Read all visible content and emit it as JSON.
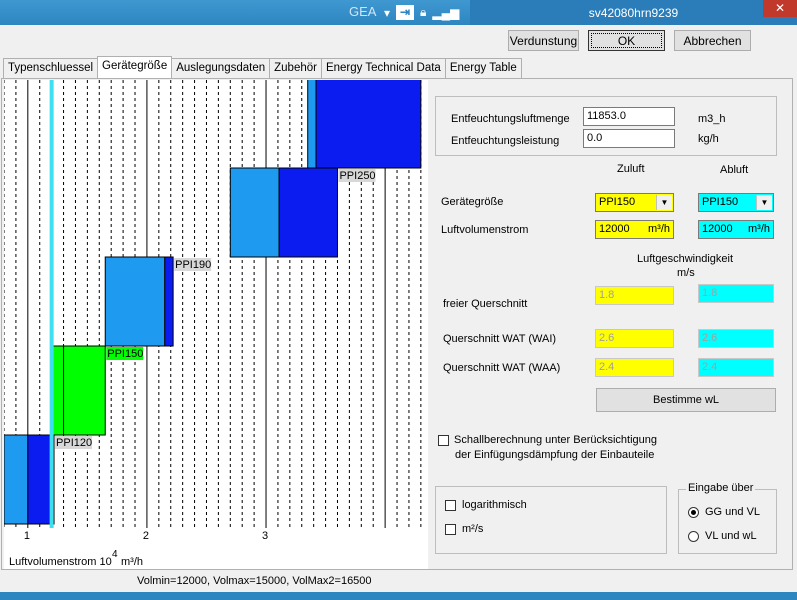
{
  "window": {
    "app_title": "GEA",
    "host_title": "sv42080hrn9239",
    "close_glyph": "✕"
  },
  "toolbar": {
    "verdunstung_label": "Verdunstung",
    "ok_label": "OK",
    "abbrechen_label": "Abbrechen"
  },
  "tabs": [
    {
      "label": "Typenschluessel"
    },
    {
      "label": "Gerätegröße"
    },
    {
      "label": "Auslegungsdaten"
    },
    {
      "label": "Zubehör"
    },
    {
      "label": "Energy Technical Data"
    },
    {
      "label": "Energy Table"
    }
  ],
  "form": {
    "entfeuchtungsluftmenge_label": "Entfeuchtungsluftmenge",
    "entfeuchtungsluftmenge_value": "11853.0",
    "entfeuchtungsluftmenge_unit": "m3_h",
    "entfeuchtungsleistung_label": "Entfeuchtungsleistung",
    "entfeuchtungsleistung_value": "0.0",
    "entfeuchtungsleistung_unit": "kg/h",
    "zuluft_header": "Zuluft",
    "abluft_header": "Abluft",
    "geraetegroesse_label": "Gerätegröße",
    "geraetegroesse_zuluft": "PPI150",
    "geraetegroesse_abluft": "PPI150",
    "luftvolumenstrom_label": "Luftvolumenstrom",
    "luftvolumenstrom_zuluft": "12000",
    "luftvolumenstrom_abluft": "12000",
    "luftvolumenstrom_unit": "m³/h",
    "luftgeschwindigkeit_header": "Luftgeschwindigkeit",
    "luftgeschwindigkeit_unit": "m/s",
    "freier_querschnitt_label": "freier Querschnitt",
    "freier_querschnitt_zuluft": "1.8",
    "freier_querschnitt_abluft": "1.8",
    "querschnitt_wai_label": "Querschnitt WAT (WAI)",
    "querschnitt_wai_zuluft": "2.6",
    "querschnitt_wai_abluft": "2.6",
    "querschnitt_waa_label": "Querschnitt WAT (WAA)",
    "querschnitt_waa_zuluft": "2.4",
    "querschnitt_waa_abluft": "2.4",
    "bestimme_label": "Bestimme wL",
    "schall_line1": "Schallberechnung unter Berücksichtigung",
    "schall_line2": "der Einfügungsdämpfung der Einbauteile",
    "log_label": "logarithmisch",
    "m2s_label": "m²/s",
    "eingabe_legend": "Eingabe über",
    "radio_gg_label": "GG und VL",
    "radio_vl_label": "VL  und  wL"
  },
  "chart_data": {
    "type": "other",
    "x_axis_label": "Luftvolumenstrom 10",
    "x_axis_exponent": "4",
    "x_axis_unit": "m³/h",
    "x_ticks": [
      "1",
      "2",
      "3"
    ],
    "cursor_x": 1.2,
    "sizes": [
      {
        "name": "PPI120",
        "x_light": [
          0.8,
          1.0
        ],
        "x_dark": [
          1.0,
          1.22
        ],
        "light_color": "#1e9bf0",
        "dark_color": "#0b1cf0"
      },
      {
        "name": "PPI150",
        "x_light": [
          1.2,
          1.3
        ],
        "x_dark": [
          1.3,
          1.65
        ],
        "light_color": "#00ff00",
        "dark_color": "#00ff00"
      },
      {
        "name": "PPI190",
        "x_light": [
          1.65,
          2.15
        ],
        "x_dark": [
          2.15,
          2.22
        ],
        "light_color": "#1e9bf0",
        "dark_color": "#0b1cf0"
      },
      {
        "name": "PPI250",
        "x_light": [
          2.7,
          3.11
        ],
        "x_dark": [
          3.11,
          3.6
        ],
        "light_color": "#1e9bf0",
        "dark_color": "#0b1cf0"
      },
      {
        "name": "",
        "x_light": [
          3.35,
          3.42
        ],
        "x_dark": [
          3.42,
          4.3
        ],
        "light_color": "#1e9bf0",
        "dark_color": "#0b1cf0"
      }
    ],
    "x_range": [
      0.8,
      4.36
    ],
    "grid": "vertical dashed"
  },
  "status": {
    "text": "Volmin=12000, Volmax=15000, VolMax2=16500"
  },
  "colors": {
    "light_blue": "#1e9bf0",
    "dark_blue": "#0b1cf0",
    "green": "#00ff00",
    "cursor": "#3de0f0",
    "yellow_field": "#ffff00",
    "cyan_field": "#00ffff"
  }
}
